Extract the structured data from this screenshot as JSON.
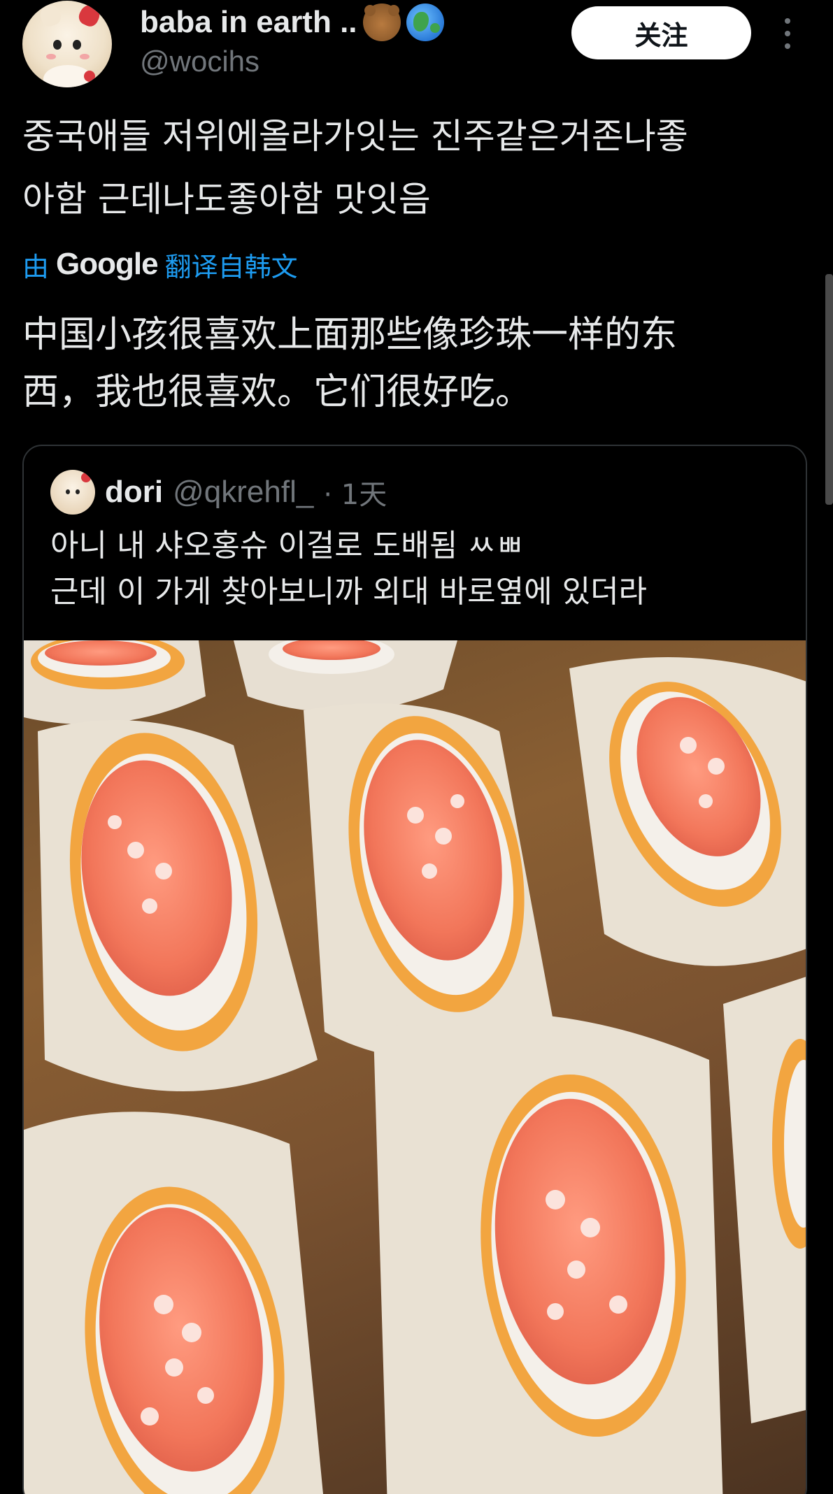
{
  "author": {
    "display_name": "baba in earth ..",
    "name_emojis": [
      "bear-face",
      "globe"
    ],
    "handle": "@wocihs"
  },
  "actions": {
    "follow_label": "关注",
    "more_icon": "ellipsis-vertical"
  },
  "tweet": {
    "text_line1": "중국애들 저위에올라가잇는 진주같은거존나좋",
    "text_line2": "아함  근데나도좋아함 맛잇음",
    "translated_prefix": "由",
    "translated_brand": "Google",
    "translated_suffix": "翻译自韩文",
    "translation_line1": "中国小孩很喜欢上面那些像珍珠一样的东",
    "translation_line2": "西，我也很喜欢。它们很好吃。"
  },
  "quoted_tweet": {
    "name": "dori",
    "handle": "@qkrehfl_",
    "time": "· 1天",
    "text_line1": "아니 내 샤오홍슈 이걸로 도배됨 ㅆㅃ",
    "text_line2": "근데 이 가게 찾아보니까 외대 바로옆에 있더라",
    "photo_description": ""
  },
  "colors": {
    "background": "#000000",
    "text": "#e7e9ea",
    "secondary": "#71767b",
    "link": "#1d9bf0",
    "border": "#2f3336"
  }
}
